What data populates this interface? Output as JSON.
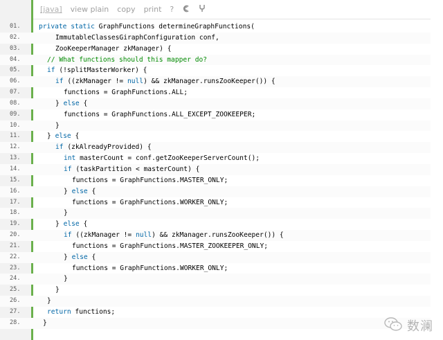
{
  "toolbar": {
    "lang": "[java]",
    "view_plain": "view plain",
    "copy": "copy",
    "print": "print",
    "help": "?"
  },
  "watermark": {
    "text": "数澜"
  },
  "lines": [
    {
      "num": "01.",
      "indent": 0,
      "tokens": [
        [
          "kw",
          "private"
        ],
        [
          "",
          ""
        ],
        [
          "kw",
          " static"
        ],
        [
          "",
          ""
        ],
        [
          "",
          " GraphFunctions determineGraphFunctions("
        ]
      ]
    },
    {
      "num": "02.",
      "indent": 4,
      "tokens": [
        [
          "",
          "ImmutableClassesGiraphConfiguration conf,"
        ]
      ]
    },
    {
      "num": "03.",
      "indent": 4,
      "tokens": [
        [
          "",
          "ZooKeeperManager zkManager) {"
        ]
      ]
    },
    {
      "num": "04.",
      "indent": 2,
      "tokens": [
        [
          "cmt",
          "// What functions should this mapper do?"
        ]
      ]
    },
    {
      "num": "05.",
      "indent": 2,
      "tokens": [
        [
          "kw",
          "if"
        ],
        [
          "",
          " (!splitMasterWorker) {"
        ]
      ]
    },
    {
      "num": "06.",
      "indent": 4,
      "tokens": [
        [
          "kw",
          "if"
        ],
        [
          "",
          " ((zkManager != "
        ],
        [
          "kw",
          "null"
        ],
        [
          "",
          ") && zkManager.runsZooKeeper()) {"
        ]
      ]
    },
    {
      "num": "07.",
      "indent": 6,
      "tokens": [
        [
          "",
          "functions = GraphFunctions.ALL;"
        ]
      ]
    },
    {
      "num": "08.",
      "indent": 4,
      "tokens": [
        [
          "",
          "} "
        ],
        [
          "kw",
          "else"
        ],
        [
          "",
          " {"
        ]
      ]
    },
    {
      "num": "09.",
      "indent": 6,
      "tokens": [
        [
          "",
          "functions = GraphFunctions.ALL_EXCEPT_ZOOKEEPER;"
        ]
      ]
    },
    {
      "num": "10.",
      "indent": 4,
      "tokens": [
        [
          "",
          "}"
        ]
      ]
    },
    {
      "num": "11.",
      "indent": 2,
      "tokens": [
        [
          "",
          "} "
        ],
        [
          "kw",
          "else"
        ],
        [
          "",
          " {"
        ]
      ]
    },
    {
      "num": "12.",
      "indent": 4,
      "tokens": [
        [
          "kw",
          "if"
        ],
        [
          "",
          " (zkAlreadyProvided) {"
        ]
      ]
    },
    {
      "num": "13.",
      "indent": 6,
      "tokens": [
        [
          "kw",
          "int"
        ],
        [
          "",
          " masterCount = conf.getZooKeeperServerCount();"
        ]
      ]
    },
    {
      "num": "14.",
      "indent": 6,
      "tokens": [
        [
          "kw",
          "if"
        ],
        [
          "",
          " (taskPartition < masterCount) {"
        ]
      ]
    },
    {
      "num": "15.",
      "indent": 8,
      "tokens": [
        [
          "",
          "functions = GraphFunctions.MASTER_ONLY;"
        ]
      ]
    },
    {
      "num": "16.",
      "indent": 6,
      "tokens": [
        [
          "",
          "} "
        ],
        [
          "kw",
          "else"
        ],
        [
          "",
          " {"
        ]
      ]
    },
    {
      "num": "17.",
      "indent": 8,
      "tokens": [
        [
          "",
          "functions = GraphFunctions.WORKER_ONLY;"
        ]
      ]
    },
    {
      "num": "18.",
      "indent": 6,
      "tokens": [
        [
          "",
          "}"
        ]
      ]
    },
    {
      "num": "19.",
      "indent": 4,
      "tokens": [
        [
          "",
          "} "
        ],
        [
          "kw",
          "else"
        ],
        [
          "",
          " {"
        ]
      ]
    },
    {
      "num": "20.",
      "indent": 6,
      "tokens": [
        [
          "kw",
          "if"
        ],
        [
          "",
          " ((zkManager != "
        ],
        [
          "kw",
          "null"
        ],
        [
          "",
          ") && zkManager.runsZooKeeper()) {"
        ]
      ]
    },
    {
      "num": "21.",
      "indent": 8,
      "tokens": [
        [
          "",
          "functions = GraphFunctions.MASTER_ZOOKEEPER_ONLY;"
        ]
      ]
    },
    {
      "num": "22.",
      "indent": 6,
      "tokens": [
        [
          "",
          "} "
        ],
        [
          "kw",
          "else"
        ],
        [
          "",
          " {"
        ]
      ]
    },
    {
      "num": "23.",
      "indent": 8,
      "tokens": [
        [
          "",
          "functions = GraphFunctions.WORKER_ONLY;"
        ]
      ]
    },
    {
      "num": "24.",
      "indent": 6,
      "tokens": [
        [
          "",
          "}"
        ]
      ]
    },
    {
      "num": "25.",
      "indent": 4,
      "tokens": [
        [
          "",
          "}"
        ]
      ]
    },
    {
      "num": "26.",
      "indent": 2,
      "tokens": [
        [
          "",
          "}"
        ]
      ]
    },
    {
      "num": "27.",
      "indent": 2,
      "tokens": [
        [
          "kw",
          "return"
        ],
        [
          "",
          " functions;"
        ]
      ]
    },
    {
      "num": "28.",
      "indent": 1,
      "tokens": [
        [
          "",
          "}"
        ]
      ]
    }
  ]
}
